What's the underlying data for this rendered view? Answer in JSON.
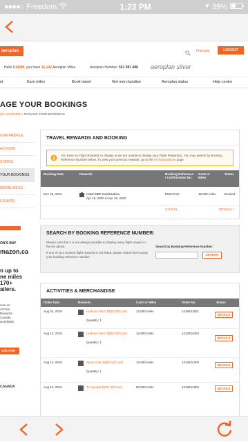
{
  "status_bar": {
    "carrier": "Freedom",
    "time": "1:23 PM",
    "battery": "39%"
  },
  "site": {
    "logo_text": "aeroplan",
    "lang": "Français",
    "logout": "LOGOUT",
    "hello_prefix": "Hello",
    "user_name": "KARIM",
    "hello_mid": ", you have",
    "miles": "16,142",
    "hello_suffix": "Aeroplan Miles",
    "number_label": "Aeroplan Number:",
    "number": "561 981 488",
    "brand": "aeroplan silver",
    "nav": [
      "nt",
      "Earn miles",
      "Book travel",
      "Get merchandise",
      "Aeroplan status",
      "Help centre"
    ],
    "page_title": "AGE YOUR BOOKINGS",
    "crumb_link": "UR ACCOUNT",
    "crumb_sep": ">",
    "crumb_current": "MANAGE YOUR BOOKINGS",
    "sidebar": [
      "OUR PROFILE",
      "ACTIONS",
      "STATUS",
      "YOUR BOOKINGS",
      "ISSING MILES",
      "COUNTS"
    ],
    "ad": {
      "line1": "ON'S BAY",
      "line2": "mazon.ca",
      "line3": "n up to",
      "line4": "ne miles",
      "line5": "170+",
      "line6": "ailers.",
      "line7": "now on",
      "line8": "ot Fare",
      "line9": "Rewards",
      "line10": "Canada",
      "line11": "worldwide.",
      "btn": "ook now",
      "footer": "CANADA"
    }
  },
  "travel": {
    "title": "TRAVEL REWARDS AND BOOKING",
    "notice": "You have no Flight Rewards to display or we are unable to display your Flight Reward(s). You may search by Booking Reference Number below. To view your previous rewards, go to the",
    "notice_link": "All Transactions",
    "notice_end": "page.",
    "headers": [
      "Booking Date",
      "Rewards",
      "Booking Reference / Confirmation No.",
      "Cash or Miles",
      "Status"
    ],
    "row": {
      "date": "Dec 26, 2019",
      "name": "Hotel WBF Nambaebisu",
      "dates": "Apr 16, 2020 to Apr 19, 2020",
      "ref": "EMLUFXJ",
      "miles": "45,600 miles",
      "status": "Booked"
    },
    "cancel": "CANCEL",
    "details": "DETAILS >"
  },
  "search": {
    "title": "SEARCH BY BOOKING REFERENCE NUMBER:",
    "note1": "Please note that it is not always possible to display every flight reward in the list above.",
    "note2": "If one of your booked flight rewards is not listed, please search for it using your booking reference number.",
    "label": "Search by Booking Reference Number:",
    "btn": "SEARCH"
  },
  "activities": {
    "title": "ACTIVITIES & MERCHANDISE",
    "headers": [
      "Order Date",
      "Rewards",
      "Cash or Miles",
      "Order No.",
      "Status"
    ],
    "rows": [
      {
        "date": "Aug 24, 2019",
        "item": "Hudson's BAY $100 Gift Card",
        "qty": "Quantity: 1",
        "miles": "12,000 miles",
        "order": "1416531501",
        "btn": "DETAILS"
      },
      {
        "date": "Aug 12, 2019",
        "item": "Hudson's BAY $100 Gift Card",
        "qty": "Quantity: 1",
        "miles": "12,000 miles",
        "order": "1412624304",
        "btn": "DETAILS"
      },
      {
        "date": "Aug 12, 2019",
        "item": "Sport Chek $100 Gift Card",
        "qty": "Quantity: 1",
        "miles": "12,000 miles",
        "order": "1412624303",
        "btn": "DETAILS"
      },
      {
        "date": "Aug 12, 2019",
        "item": "Tr Canada $100 Gift Card",
        "qty": "",
        "miles": "50,000 miles",
        "order": "1412624302",
        "btn": "DETAILS"
      }
    ]
  },
  "colors": {
    "accent": "#f26522",
    "header_gray": "#777777"
  }
}
